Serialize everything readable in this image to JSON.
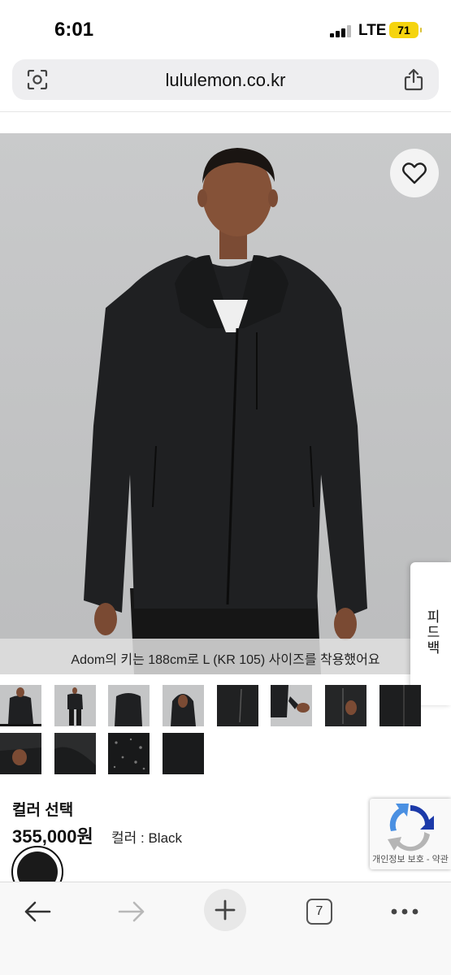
{
  "status_bar": {
    "time": "6:01",
    "network": "LTE",
    "battery": "71",
    "battery_color": "#f5d40f"
  },
  "browser": {
    "url": "lululemon.co.kr",
    "left_icon": "visual-search-icon",
    "right_icon": "share-icon",
    "toolbar": {
      "back_icon": "back-arrow-icon",
      "forward_icon": "forward-arrow-icon",
      "new_tab_icon": "plus-icon",
      "tab_count": "7",
      "more_icon": "more-dots-icon"
    }
  },
  "product": {
    "image_alt": "Adom의 키는 188cm로 L (KR 105) 사이즈를 착용했어요",
    "model_caption": "Adom의 키는 188cm로 L (KR 105) 사이즈를 착용했어요",
    "wishlist_icon": "heart-icon",
    "color_heading": "컬러 선택",
    "price": "355,000원",
    "color_label": "컬러 : Black",
    "selected_swatch_color": "#1a1a1a",
    "thumbnail_count": 12
  },
  "side_tab": {
    "label": "피드백"
  },
  "recaptcha": {
    "text": "개인정보 보호 - 약관"
  }
}
